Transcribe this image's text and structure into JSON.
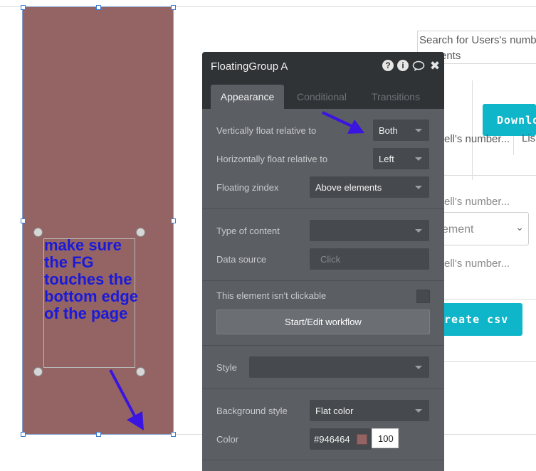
{
  "canvas": {
    "search_text_line1": "Search for Users's numb",
    "search_text_line2": "ents",
    "download_button": "Downlo",
    "cell_number_1": "ell's number...",
    "cell_number_2": "ell's number...",
    "cell_number_3": "ell's number...",
    "dropdown_value": "ement",
    "list_stub": "Lis",
    "create_csv_button": "reate csv"
  },
  "annotation": {
    "text": "make sure the FG touches the bottom edge of the page",
    "color": "#1a1ad8"
  },
  "floating_group": {
    "fill": "#946464"
  },
  "panel": {
    "title": "FloatingGroup A",
    "tabs": [
      "Appearance",
      "Conditional",
      "Transitions"
    ],
    "vertical_label": "Vertically float relative to",
    "vertical_value": "Both",
    "horizontal_label": "Horizontally float relative to",
    "horizontal_value": "Left",
    "zindex_label": "Floating zindex",
    "zindex_value": "Above elements",
    "content_type_label": "Type of content",
    "content_type_value": "",
    "data_source_label": "Data source",
    "data_source_placeholder": "Click",
    "not_clickable_label": "This element isn't clickable",
    "workflow_button": "Start/Edit workflow",
    "style_label": "Style",
    "style_value": "",
    "bg_style_label": "Background style",
    "bg_style_value": "Flat color",
    "color_label": "Color",
    "color_value": "#946464",
    "opacity_value": "100"
  }
}
